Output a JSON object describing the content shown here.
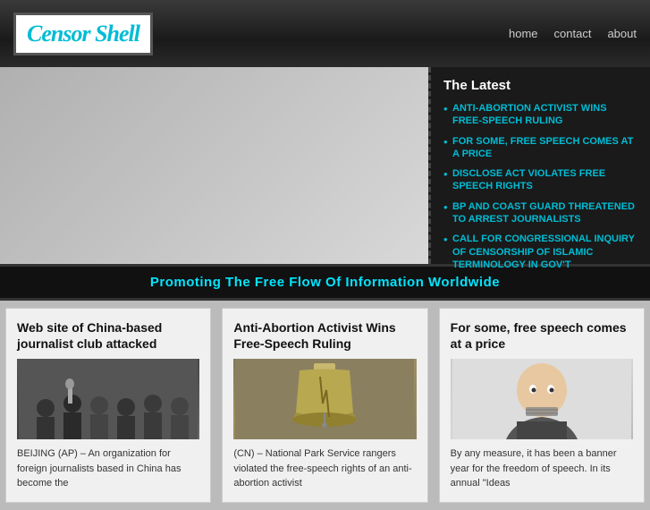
{
  "header": {
    "logo_part1": "Censor",
    "logo_part2": "Shell",
    "nav": [
      {
        "label": "home",
        "href": "#"
      },
      {
        "label": "contact",
        "href": "#"
      },
      {
        "label": "about",
        "href": "#"
      }
    ]
  },
  "hero": {
    "latest_title": "The Latest",
    "latest_items": [
      {
        "text": "ANTI-ABORTION ACTIVIST WINS FREE-SPEECH RULING",
        "href": "#"
      },
      {
        "text": "FOR SOME, FREE SPEECH COMES AT A PRICE",
        "href": "#"
      },
      {
        "text": "DISCLOSE ACT VIOLATES FREE SPEECH RIGHTS",
        "href": "#"
      },
      {
        "text": "BP AND COAST GUARD THREATENED TO ARREST JOURNALISTS",
        "href": "#"
      },
      {
        "text": "CALL FOR CONGRESSIONAL INQUIRY OF CENSORSHIP OF ISLAMIC TERMINOLOGY IN GOV'T",
        "href": "#"
      }
    ]
  },
  "tagline": "Promoting The Free Flow Of Information Worldwide",
  "articles": [
    {
      "title": "Web site of China-based journalist club attacked",
      "excerpt": "BEIJING (AP) – An organization for foreign journalists based in China has become the",
      "img_type": "china"
    },
    {
      "title": "Anti-Abortion Activist Wins Free-Speech Ruling",
      "excerpt": "(CN) – National Park Service rangers violated the free-speech rights of an anti-abortion activist",
      "img_type": "bell"
    },
    {
      "title": "For some, free speech comes at a price",
      "excerpt": "By any measure, it has been a banner year for the freedom of speech. In its annual \"Ideas",
      "img_type": "man"
    }
  ]
}
